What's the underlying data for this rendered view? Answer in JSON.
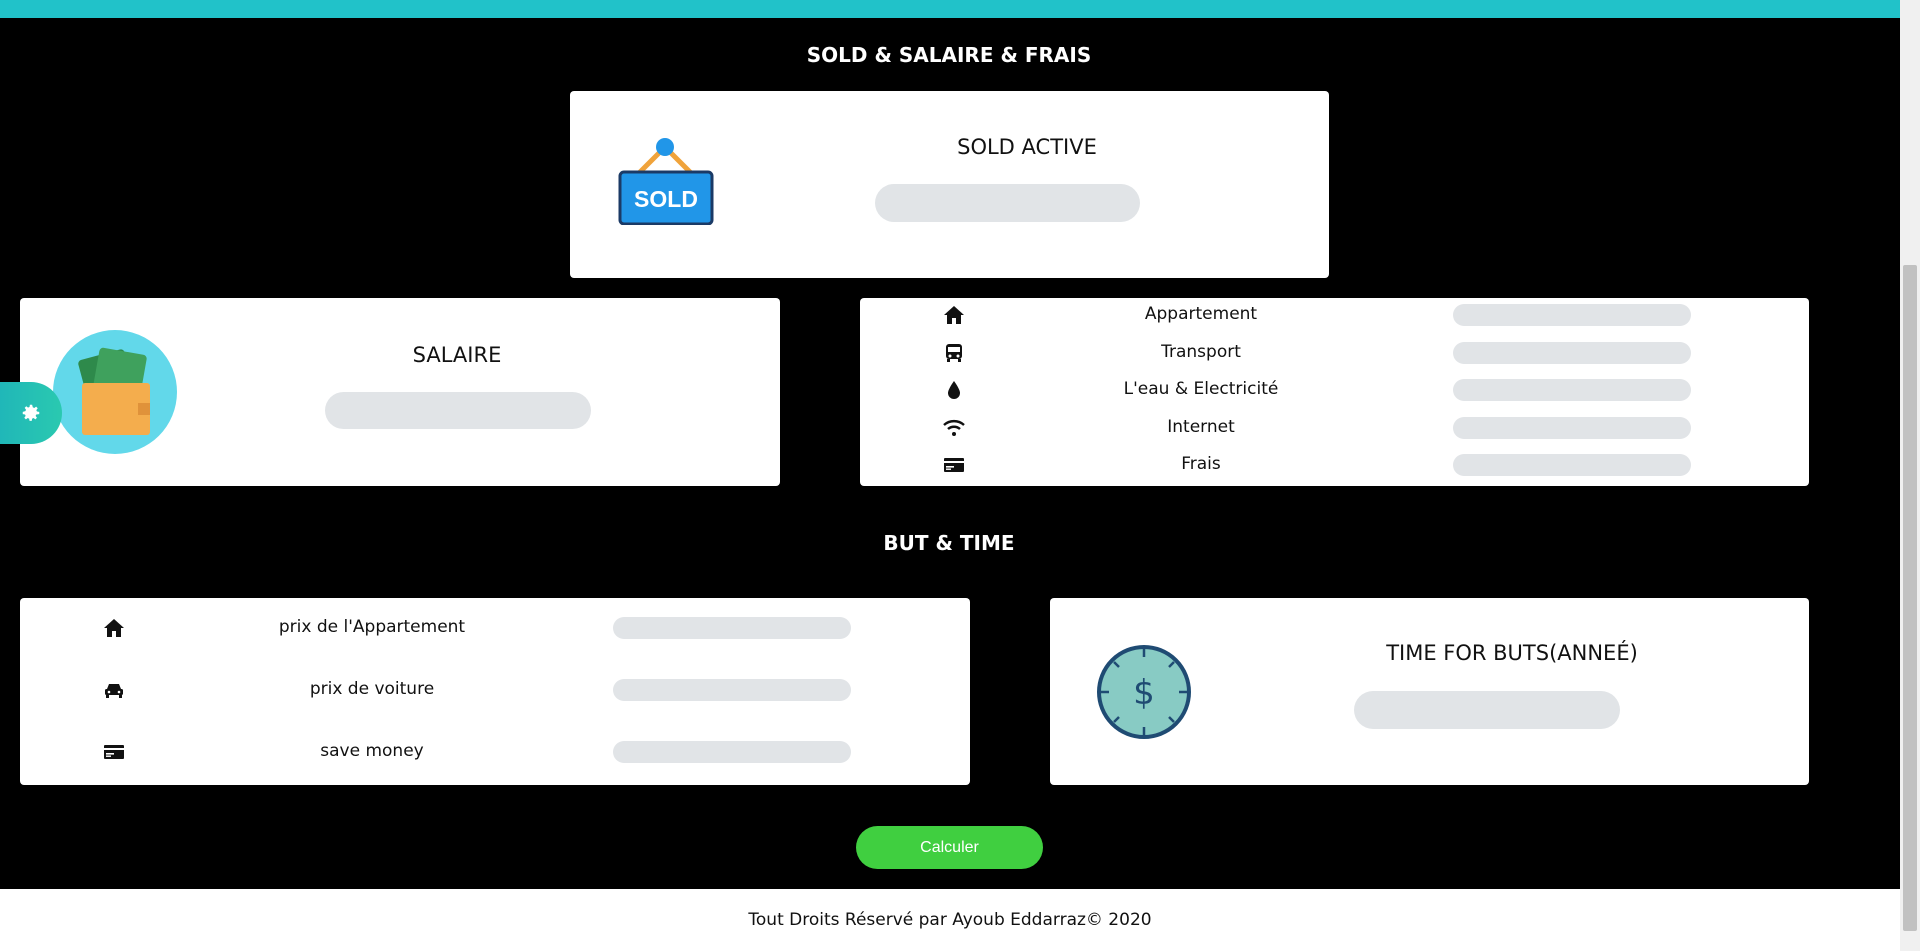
{
  "sections": {
    "sold_title": "SOLD & SALAIRE & FRAIS",
    "but_title": "BUT & TIME"
  },
  "sold_card": {
    "label": "SOLD ACTIVE",
    "sign_text": "SOLD"
  },
  "salaire_card": {
    "label": "SALAIRE"
  },
  "frais_card": {
    "items": [
      {
        "icon": "home-icon",
        "label": "Appartement"
      },
      {
        "icon": "bus-icon",
        "label": "Transport"
      },
      {
        "icon": "water-drop-icon",
        "label": "L'eau & Electricité"
      },
      {
        "icon": "wifi-icon",
        "label": "Internet"
      },
      {
        "icon": "credit-card-icon",
        "label": "Frais"
      }
    ]
  },
  "buts_card": {
    "items": [
      {
        "icon": "home-icon",
        "label": "prix de l'Appartement"
      },
      {
        "icon": "car-icon",
        "label": "prix de voiture"
      },
      {
        "icon": "credit-card-icon",
        "label": "save money"
      }
    ]
  },
  "time_card": {
    "label": "TIME FOR BUTS(ANNEÉ)",
    "clock_symbol": "$"
  },
  "actions": {
    "calculate_label": "Calculer"
  },
  "footer": {
    "text": "Tout Droits Réservé par Ayoub Eddarraz© 2020"
  },
  "colors": {
    "accent": "#21c2c9",
    "button": "#40cf40",
    "field": "#e1e4e7"
  }
}
